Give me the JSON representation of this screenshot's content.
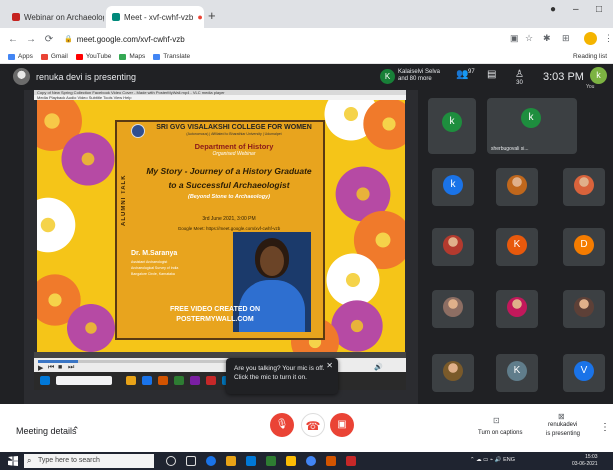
{
  "browser": {
    "tabs": [
      {
        "label": "Webinar on Archaeology - 10/...",
        "active": false
      },
      {
        "label": "Meet - xvf-cwhf-vzb",
        "active": true
      }
    ],
    "new_tab": "+",
    "url": "meet.google.com/xvf-cwhf-vzb",
    "bookmarks": [
      "Apps",
      "Gmail",
      "YouTube",
      "Maps",
      "Translate"
    ],
    "reading_list": "Reading list"
  },
  "meet": {
    "presenting_text": "renuka devi is presenting",
    "people_avatar_letter": "K",
    "people_line1": "Kalaiselvi Selva",
    "people_line2": "and 80 more",
    "participants_count": "97",
    "activities_count": "30",
    "time": "3:03 PM",
    "self_avatar_letter": "k",
    "self_label": "You",
    "pinned_name": "sherbugovali si...",
    "mic_popup_text": "Are you talking? Your mic is off. Click the mic to turn it on.",
    "meeting_details": "Meeting details",
    "captions_label": "Turn on captions",
    "present_label_line1": "renukadevi",
    "present_label_line2": "is presenting"
  },
  "slide": {
    "window_title": "Copy of New Spring Collection Facebook Video Cover - Made with PosterMyWall.mp4 - VLC media player",
    "window_menu": "Media  Playback  Audio  Video  Subtitle  Tools  View  Help",
    "alumni_talk": "ALUMNI TALK",
    "college": "SRI GVG VISALAKSHI COLLEGE FOR WOMEN",
    "college_sub": "(Autonomous) | Affiliated to Bharathiar University | Udumalpet",
    "department": "Department of History",
    "organised": "Organised Webinar",
    "title_line1": "My Story - Journey of a History Graduate",
    "title_line2": "to a Successful Archaeologist",
    "subtitle": "(Beyond Stone to Archaeology)",
    "date": "3rd June 2021, 3:00 PM",
    "meet_link": "Google Meet: https://meet.google.com/xvf-cwhf-vzb",
    "speaker": "Dr. M.Saranya",
    "speaker_role1": "Assistant Archaeologist",
    "speaker_role2": "Archaeological Survey of India",
    "speaker_role3": "Bangalore Circle, Karnataka",
    "watermark_line1": "FREE VIDEO CREATED ON",
    "watermark_line2": "POSTERMYWALL.COM"
  },
  "participants": [
    {
      "type": "letter",
      "letter": "k",
      "color": "#1e8e3e"
    },
    {
      "type": "letter",
      "letter": "k",
      "color": "#1a73e8"
    },
    {
      "type": "photo",
      "color": "#c0671c"
    },
    {
      "type": "photo",
      "color": "#d9633b"
    },
    {
      "type": "photo",
      "color": "#b43a2e"
    },
    {
      "type": "letter",
      "letter": "K",
      "color": "#e8590c"
    },
    {
      "type": "letter",
      "letter": "D",
      "color": "#f57c00"
    },
    {
      "type": "photo",
      "color": "#8d6e63"
    },
    {
      "type": "photo",
      "color": "#c2185b"
    },
    {
      "type": "photo",
      "color": "#5d4037"
    },
    {
      "type": "photo",
      "color": "#7a5a2a"
    },
    {
      "type": "letter",
      "letter": "K",
      "color": "#607d8b"
    },
    {
      "type": "letter",
      "letter": "V",
      "color": "#1a73e8"
    }
  ],
  "taskbar": {
    "search_placeholder": "Type here to search",
    "tray": "ENG",
    "clock_time": "15:03",
    "clock_date": "03-06-2021"
  },
  "colors": {
    "meet_bg": "#202124",
    "slide_yellow": "#f5c518",
    "danger_red": "#ea4335"
  }
}
